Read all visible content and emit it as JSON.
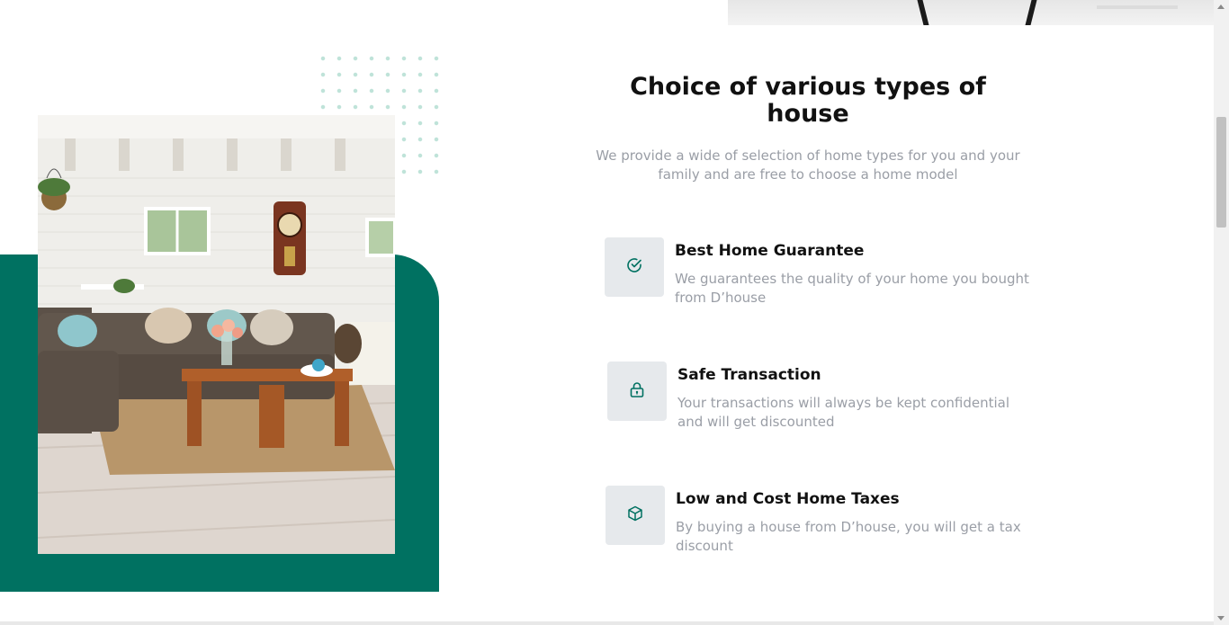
{
  "section": {
    "title": "Choice of various types of house",
    "description": "We provide a wide of selection of home types for you and your family and are free to choose a home model"
  },
  "features": [
    {
      "icon": "check-circle-icon",
      "title": "Best Home Guarantee",
      "description": "We guarantees the quality of your home you bought from D’house"
    },
    {
      "icon": "lock-icon",
      "title": "Safe Transaction",
      "description": "Your transactions will always be kept confidential and will get discounted"
    },
    {
      "icon": "cube-icon",
      "title": "Low and Cost Home Taxes",
      "description": "By buying a house from D’house, you will get a tax discount"
    }
  ],
  "colors": {
    "accent": "#007161",
    "icon_background": "#e6e9ec",
    "muted_text": "#9a9ea6",
    "dots": "#bfe3d9"
  }
}
